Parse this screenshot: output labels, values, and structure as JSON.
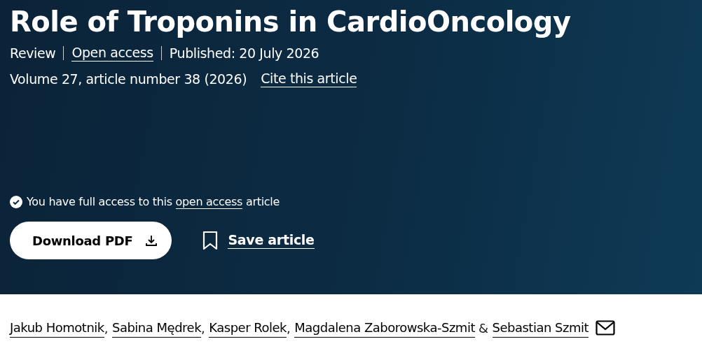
{
  "article": {
    "title": "Role of Troponins in CardioOncology",
    "meta": [
      {
        "text": "Review",
        "kind": "text"
      },
      {
        "text": "Open access",
        "kind": "link"
      },
      {
        "text": "Published: 20 July 2026",
        "kind": "text"
      }
    ],
    "citation": "Volume 27, article number 38 (2026)",
    "cite_link": "Cite this article",
    "access": {
      "before": "You have full access to this",
      "link": "open access",
      "after": "article"
    },
    "download_button": "Download PDF",
    "save_link": "Save article"
  },
  "authors": [
    {
      "name": "Jakub Homotnik",
      "separator": ","
    },
    {
      "name": "Sabina Mędrek",
      "separator": ","
    },
    {
      "name": "Kasper Rolek",
      "separator": ","
    },
    {
      "name": "Magdalena Zaborowska-Szmit",
      "separator": "&"
    },
    {
      "name": "Sebastian Szmit",
      "mail": true
    }
  ]
}
